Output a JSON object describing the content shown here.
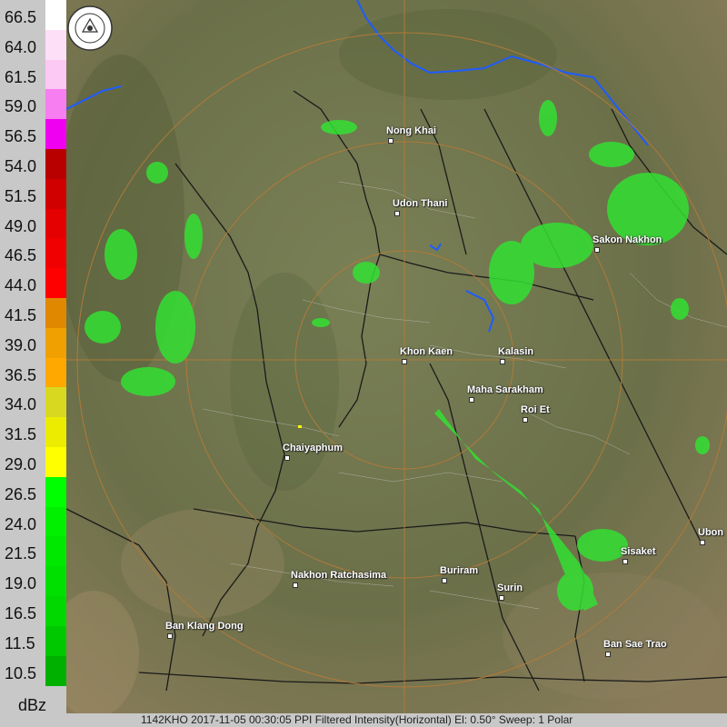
{
  "legend": {
    "unit": "dBz",
    "levels": [
      {
        "label": "66.5",
        "color": "#ffffff"
      },
      {
        "label": "64.0",
        "color": "#fde0f8"
      },
      {
        "label": "61.5",
        "color": "#fcc8f4"
      },
      {
        "label": "59.0",
        "color": "#f77ef0"
      },
      {
        "label": "56.5",
        "color": "#f000f0"
      },
      {
        "label": "54.0",
        "color": "#b80000"
      },
      {
        "label": "51.5",
        "color": "#d00000"
      },
      {
        "label": "49.0",
        "color": "#e40000"
      },
      {
        "label": "46.5",
        "color": "#f00000"
      },
      {
        "label": "44.0",
        "color": "#ff0000"
      },
      {
        "label": "41.5",
        "color": "#e08800"
      },
      {
        "label": "39.0",
        "color": "#f0a000"
      },
      {
        "label": "36.5",
        "color": "#ffa800"
      },
      {
        "label": "34.0",
        "color": "#d8d820"
      },
      {
        "label": "31.5",
        "color": "#ecec00"
      },
      {
        "label": "29.0",
        "color": "#ffff00"
      },
      {
        "label": "26.5",
        "color": "#00ff00"
      },
      {
        "label": "24.0",
        "color": "#00f000"
      },
      {
        "label": "21.5",
        "color": "#00e800"
      },
      {
        "label": "19.0",
        "color": "#00e000"
      },
      {
        "label": "16.5",
        "color": "#00d800"
      },
      {
        "label": "11.5",
        "color": "#00c800"
      },
      {
        "label": "10.5",
        "color": "#00b000"
      }
    ]
  },
  "cities": [
    {
      "name": "Nong Khai"
    },
    {
      "name": "Udon Thani"
    },
    {
      "name": "Sakon Nakhon"
    },
    {
      "name": "Khon Kaen"
    },
    {
      "name": "Kalasin"
    },
    {
      "name": "Maha Sarakham"
    },
    {
      "name": "Roi Et"
    },
    {
      "name": "Chaiyaphum"
    },
    {
      "name": "Ubon"
    },
    {
      "name": "Sisaket"
    },
    {
      "name": "Nakhon Ratchasima"
    },
    {
      "name": "Buriram"
    },
    {
      "name": "Surin"
    },
    {
      "name": "Ban Klang Dong"
    },
    {
      "name": "Ban Sae Trao"
    }
  ],
  "footer": {
    "text": "1142KHO 2017-11-05 00:30:05 PPI Filtered Intensity(Horizontal)  El: 0.50°  Sweep: 1 Polar"
  },
  "colors": {
    "terrain": "#6e7450",
    "range_ring": "#b07a3a",
    "border": "#1a1a1a",
    "water": "#1e5cff",
    "echo": "#33e033"
  }
}
